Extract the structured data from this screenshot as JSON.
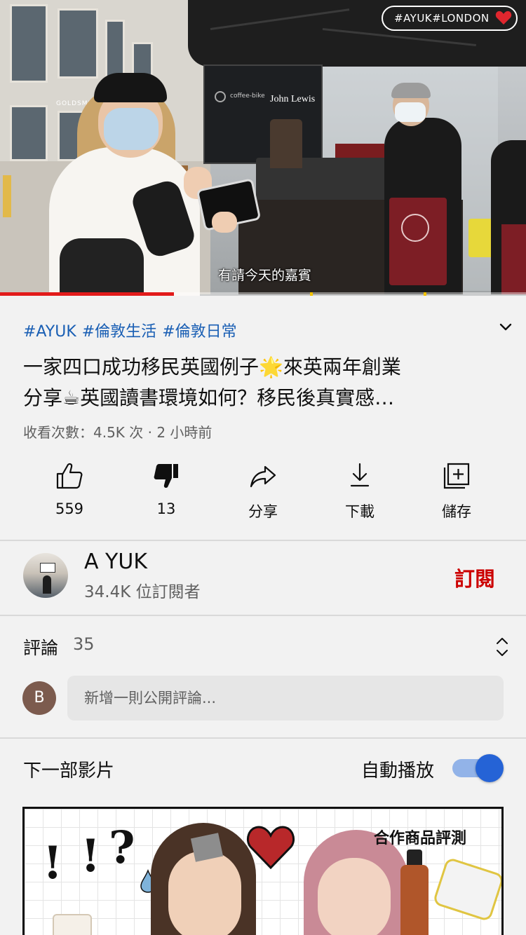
{
  "player": {
    "watermark": "#AYUK#LONDON",
    "subtitle": "有請今天的嘉賓",
    "progress_fraction": 0.33
  },
  "video": {
    "hashtags": [
      "#AYUK",
      "#倫敦生活",
      "#倫敦日常"
    ],
    "title_line1": "一家四口成功移民英國例子🌟來英兩年創業",
    "title_line2": "分享☕英國讀書環境如何？移民後真實感…",
    "meta": "收看次數：4.5K 次 · 2 小時前"
  },
  "actions": {
    "like": "559",
    "dislike": "13",
    "share": "分享",
    "download": "下載",
    "save": "儲存"
  },
  "channel": {
    "name": "A YUK",
    "subscribers": "34.4K 位訂閱者",
    "subscribe_label": "訂閱"
  },
  "comments": {
    "label": "評論",
    "count": "35",
    "user_initial": "B",
    "placeholder": "新增一則公開評論..."
  },
  "up_next": {
    "label": "下一部影片",
    "autoplay_label": "自動播放",
    "autoplay_on": true,
    "thumbnail_tag": "合作商品評測"
  },
  "colors": {
    "accent_red": "#cc0000",
    "progress_red": "#e21b1b",
    "hashtag_blue": "#1a5fb4",
    "toggle_blue": "#2563d6"
  },
  "icons": {
    "like": "thumbs-up-icon",
    "dislike": "thumbs-down-icon",
    "share": "share-arrow-icon",
    "download": "download-icon",
    "save": "add-to-playlist-icon",
    "expand": "chevron-down-icon",
    "sort": "unfold-icon"
  }
}
